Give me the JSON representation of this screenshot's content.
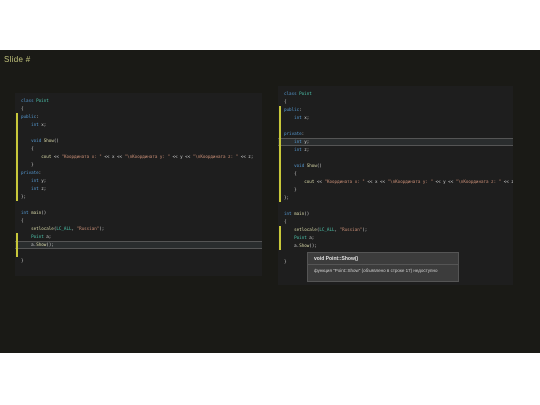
{
  "slide": {
    "title": "Slide #"
  },
  "left_editor": {
    "lines": [
      "class Point",
      "{",
      "public:",
      "    int x;",
      "",
      "    void Show()",
      "    {",
      "        cout << \"Координата x: \" << x << \"\\nКоордината y: \" << y << \"\\nКоордината z: \" << z;",
      "    }",
      "private:",
      "    int y;",
      "    int z;",
      "};",
      "",
      "int main()",
      "{",
      "    setlocale(LC_ALL, \"Russian\");",
      "    Point a;",
      "    a.Show();",
      "",
      "}"
    ]
  },
  "right_editor": {
    "lines": [
      "class Point",
      "{",
      "public:",
      "    int x;",
      "",
      "private:",
      "    int y;",
      "    int z;",
      "",
      "    void Show()",
      "    {",
      "        cout << \"Координата x: \" << x << \"\\nКоордината y: \" << y << \"\\nКоордината z: \" << z;",
      "    }",
      "};",
      "",
      "int main()",
      "{",
      "    setlocale(LC_ALL, \"Russian\");",
      "    Point a;",
      "    a.Show();",
      "",
      "}"
    ]
  },
  "tooltip": {
    "signature": "void Point::Show()",
    "message": "функция \"Point::Show\" (объявлено в строке 17) недоступно"
  },
  "colors": {
    "background": "#1a1a16",
    "editor": "#1e1e1e",
    "gutter_mark": "#c8c83a",
    "keyword": "#569cd6",
    "string": "#ce9178"
  }
}
